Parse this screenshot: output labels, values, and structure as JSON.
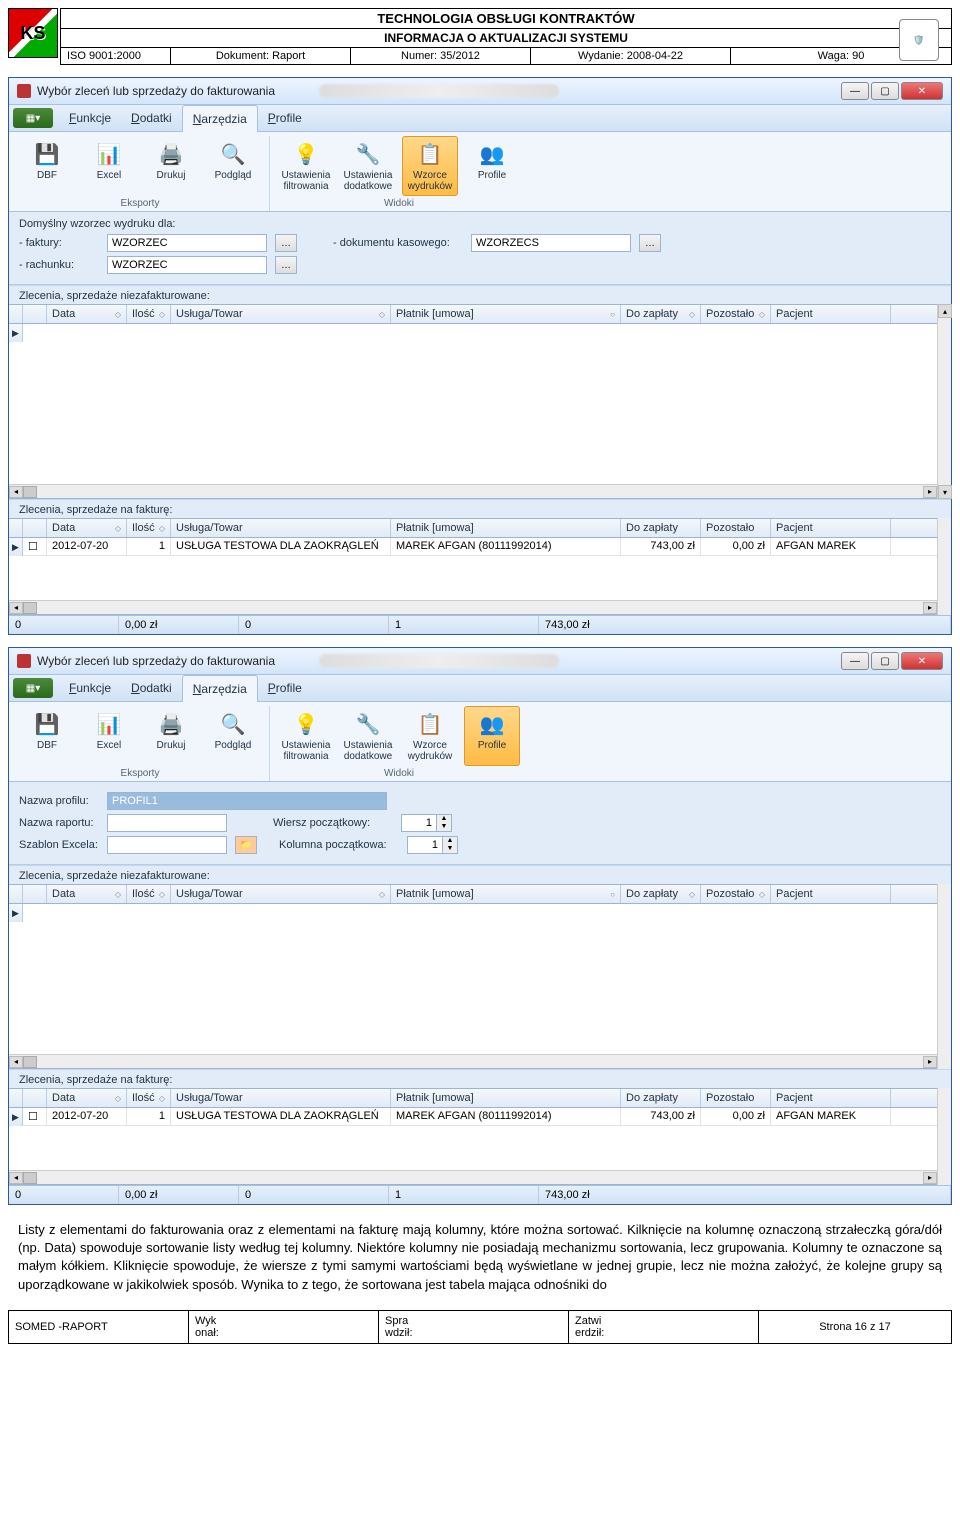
{
  "doc_header": {
    "title": "TECHNOLOGIA OBSŁUGI KONTRAKTÓW",
    "subtitle": "INFORMACJA O AKTUALIZACJI SYSTEMU",
    "iso": "ISO 9001:2000",
    "dokument": "Dokument: Raport",
    "numer": "Numer: 35/2012",
    "wydanie": "Wydanie: 2008-04-22",
    "waga": "Waga: 90",
    "logo_text": "KS"
  },
  "window1": {
    "title": "Wybór zleceń lub sprzedaży do fakturowania",
    "menu": {
      "funkcje": "Funkcje",
      "dodatki": "Dodatki",
      "narzedzia": "Narzędzia",
      "profile": "Profile"
    },
    "ribbon": {
      "group_eksporty": "Eksporty",
      "group_widoki": "Widoki",
      "dbf": "DBF",
      "excel": "Excel",
      "drukuj": "Drukuj",
      "podglad": "Podgląd",
      "ust_filtr": "Ustawienia filtrowania",
      "ust_dod": "Ustawienia dodatkowe",
      "wzorce": "Wzorce wydruków",
      "profile": "Profile"
    },
    "panel": {
      "header": "Domyślny wzorzec wydruku dla:",
      "faktury_label": "- faktury:",
      "faktury_value": "WZORZEC",
      "dokument_label": "- dokumentu kasowego:",
      "dokument_value": "WZORZECS",
      "rachunku_label": "- rachunku:",
      "rachunku_value": "WZORZEC"
    },
    "section1": "Zlecenia, sprzedaże niezafakturowane:",
    "section2": "Zlecenia, sprzedaże na fakturę:",
    "columns": {
      "data": "Data",
      "ilosc": "Ilość",
      "usluga": "Usługa/Towar",
      "platnik": "Płatnik [umowa]",
      "zaplaty": "Do zapłaty",
      "pozostalo": "Pozostało",
      "pacjent": "Pacjent"
    },
    "row": {
      "data": "2012-07-20",
      "ilosc": "1",
      "usluga": "USŁUGA TESTOWA DLA ZAOKRĄGLEŃ",
      "platnik": "MAREK AFGAN (80111992014)",
      "zaplaty": "743,00 zł",
      "pozostalo": "0,00 zł",
      "pacjent": "AFGAN MAREK"
    },
    "status": {
      "c1": "0",
      "c2": "0,00 zł",
      "c3": "0",
      "c4": "1",
      "c5": "743,00 zł"
    }
  },
  "window2": {
    "title": "Wybór zleceń lub sprzedaży do fakturowania",
    "panel": {
      "nazwa_profilu_label": "Nazwa profilu:",
      "nazwa_profilu_value": "PROFIL1",
      "nazwa_raportu_label": "Nazwa raportu:",
      "szablon_label": "Szablon Excela:",
      "wiersz_label": "Wiersz początkowy:",
      "wiersz_value": "1",
      "kolumna_label": "Kolumna początkowa:",
      "kolumna_value": "1"
    }
  },
  "body_text": "Listy z elementami do fakturowania oraz z elementami na fakturę mają kolumny, które można sortować. Kilknięcie na kolumnę oznaczoną strzałeczką góra/dół (np. Data) spowoduje sortowanie listy według tej kolumny. Niektóre kolumny nie posiadają mechanizmu sortowania, lecz grupowania. Kolumny te oznaczone są małym kółkiem. Kliknięcie spowoduje, że wiersze z tymi samymi wartościami będą wyświetlane w jednej grupie, lecz nie można założyć, że kolejne grupy są uporządkowane w jakikolwiek sposób. Wynika to z tego, że sortowana jest tabela mająca odnośniki do",
  "doc_footer": {
    "c1": "SOMED -RAPORT",
    "c2a": "Wyk",
    "c2b": "onał:",
    "c3a": "Spra",
    "c3b": "wdził:",
    "c4a": "Zatwi",
    "c4b": "erdził:",
    "c5": "Strona 16 z 17"
  }
}
